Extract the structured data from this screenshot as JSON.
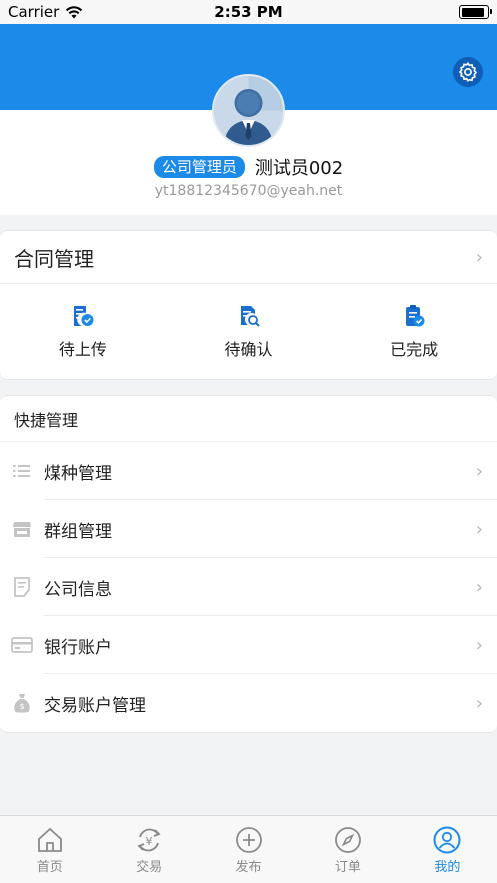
{
  "status_bar": {
    "carrier": "Carrier",
    "time": "2:53 PM",
    "battery_level": 0.95
  },
  "profile": {
    "role": "公司管理员",
    "name": "测试员002",
    "email": "yt18812345670@yeah.net"
  },
  "contract": {
    "title": "合同管理",
    "items": [
      {
        "label": "待上传",
        "icon": "upload-doc-icon"
      },
      {
        "label": "待确认",
        "icon": "search-doc-icon"
      },
      {
        "label": "已完成",
        "icon": "check-clipboard-icon"
      }
    ]
  },
  "quick": {
    "title": "快捷管理",
    "items": [
      {
        "label": "煤种管理",
        "icon": "list-icon"
      },
      {
        "label": "群组管理",
        "icon": "store-icon"
      },
      {
        "label": "公司信息",
        "icon": "document-icon"
      },
      {
        "label": "银行账户",
        "icon": "card-icon"
      },
      {
        "label": "交易账户管理",
        "icon": "money-bag-icon"
      }
    ]
  },
  "tabs": [
    {
      "label": "首页",
      "icon": "home-icon"
    },
    {
      "label": "交易",
      "icon": "exchange-icon"
    },
    {
      "label": "发布",
      "icon": "plus-circle-icon"
    },
    {
      "label": "订单",
      "icon": "compass-icon"
    },
    {
      "label": "我的",
      "icon": "user-icon",
      "active": true
    }
  ],
  "colors": {
    "accent": "#1b8ae8",
    "dark_accent": "#0e5fb5"
  }
}
